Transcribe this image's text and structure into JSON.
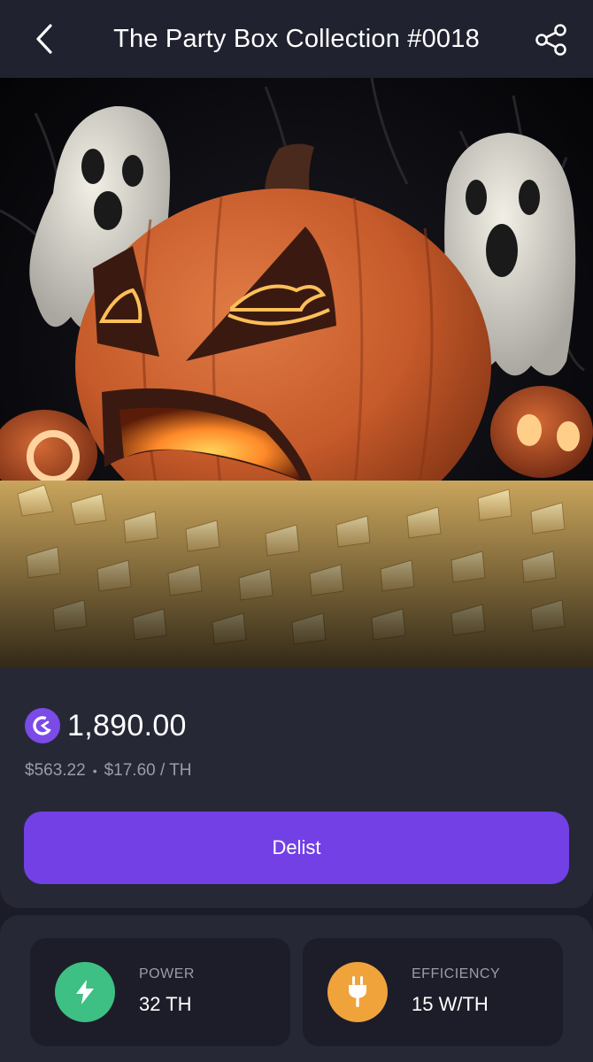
{
  "header": {
    "title": "The Party Box Collection #0018",
    "back_icon": "chevron-left-icon",
    "share_icon": "share-icon"
  },
  "hero": {
    "description_icon": "nft-artwork"
  },
  "price": {
    "currency_icon": "gomining-token-icon",
    "amount": "1,890.00",
    "usd_value": "$563.22",
    "separator": "•",
    "per_th": "$17.60 / TH",
    "delist_label": "Delist"
  },
  "stats": {
    "power": {
      "icon": "lightning-icon",
      "label": "POWER",
      "value": "32 TH"
    },
    "efficiency": {
      "icon": "plug-icon",
      "label": "EFFICIENCY",
      "value": "15 W/TH"
    }
  },
  "colors": {
    "accent": "#7340e6",
    "power_green": "#3ebf84",
    "efficiency_orange": "#f0a33a",
    "background": "#1b1c28",
    "card": "#262836"
  }
}
